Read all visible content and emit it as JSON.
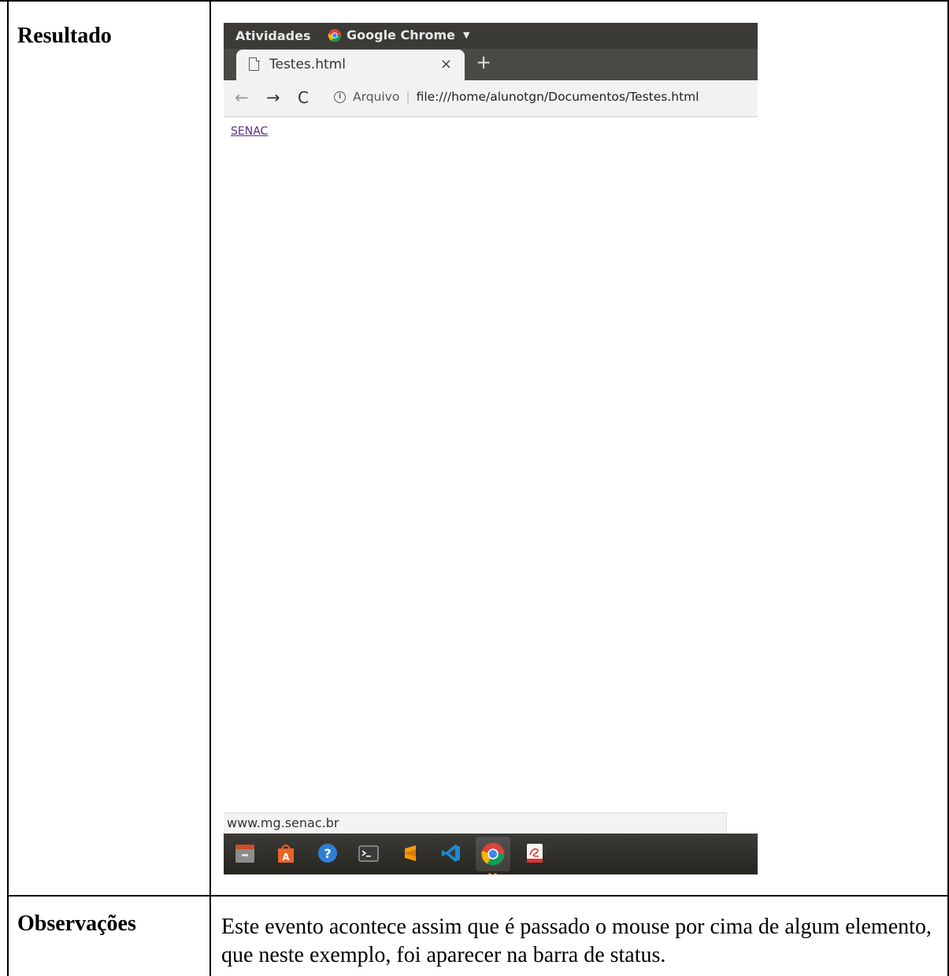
{
  "document": {
    "row1_label": "Resultado",
    "row2_label": "Observações",
    "observations_text": "Este evento acontece assim que é passado o mouse por cima de algum elemento, que neste exemplo, foi aparecer na barra de status."
  },
  "desktop": {
    "activities": "Atividades",
    "app_name": "Google Chrome"
  },
  "browser": {
    "tab_title": "Testes.html",
    "tab_close": "×",
    "new_tab": "+",
    "back": "←",
    "forward": "→",
    "reload": "C",
    "site_info": "Arquivo",
    "separator": "|",
    "url": "file:///home/alunotgn/Documentos/Testes.html",
    "page_link": "SENAC",
    "status_url": "www.mg.senac.br"
  },
  "dock": {
    "items": [
      "files-icon",
      "software-center-icon",
      "help-icon",
      "terminal-icon",
      "sublime-icon",
      "vscode-icon",
      "chrome-icon",
      "libreoffice-draw-icon"
    ]
  },
  "colors": {
    "topbar": "#3b3a37",
    "link_visited": "#5a2b8c",
    "chrome_red": "#db4437",
    "chrome_yellow": "#f4b400",
    "chrome_green": "#0f9d58",
    "chrome_blue": "#4285f4"
  }
}
